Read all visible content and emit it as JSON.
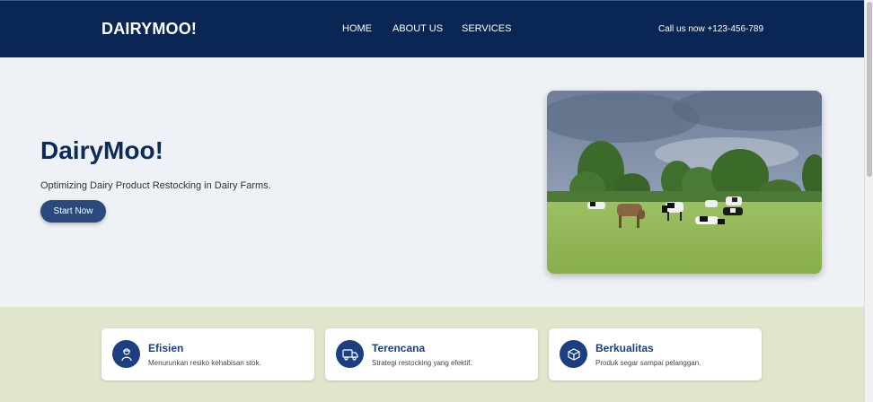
{
  "nav": {
    "brand": "DAIRYMOO!",
    "links": [
      "HOME",
      "ABOUT US",
      "SERVICES"
    ],
    "call": "Call us now +123-456-789"
  },
  "hero": {
    "title": "DairyMoo!",
    "subtitle": "Optimizing Dairy Product Restocking in Dairy Farms.",
    "button": "Start Now",
    "image": "cows-grazing-in-pasture"
  },
  "features": [
    {
      "icon": "farmer-icon",
      "title": "Efisien",
      "text": "Menurunkan resiko kehabisan stok."
    },
    {
      "icon": "truck-icon",
      "title": "Terencana",
      "text": "Strategi restocking yang efektif."
    },
    {
      "icon": "box-icon",
      "title": "Berkualitas",
      "text": "Produk segar sampai pelanggan."
    }
  ],
  "colors": {
    "navbar": "#0a2655",
    "accent": "#1b3f80",
    "features_bg": "#dfe6cc"
  }
}
